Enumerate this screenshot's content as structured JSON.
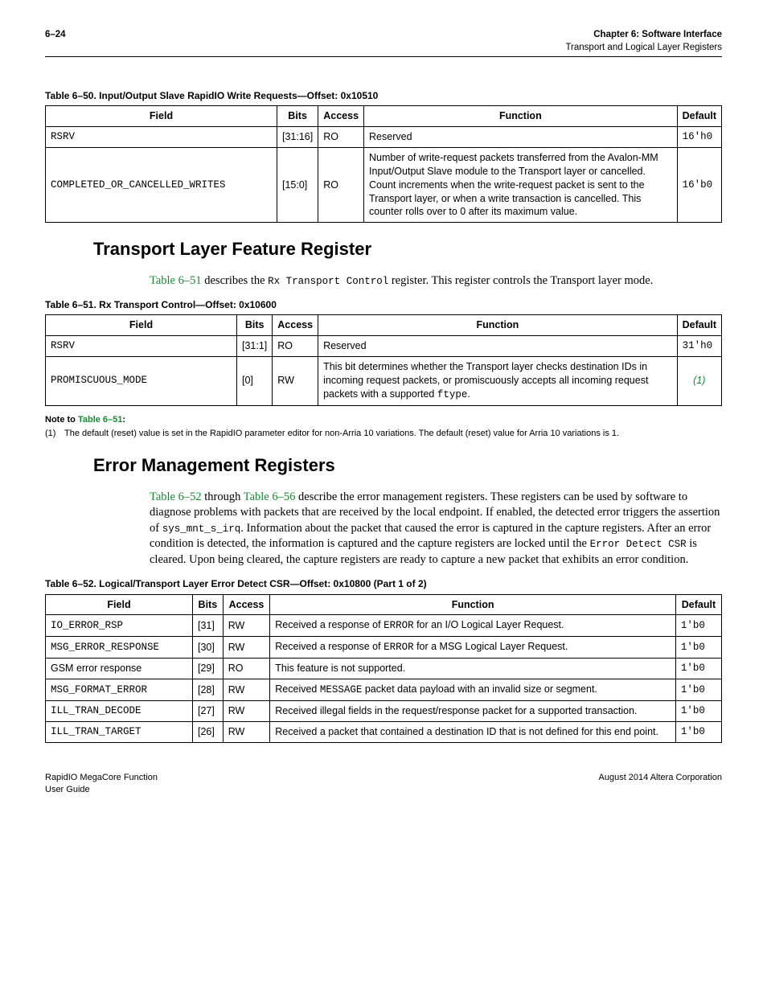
{
  "header": {
    "page": "6–24",
    "chapter": "Chapter 6:  Software Interface",
    "subtitle": "Transport and Logical Layer Registers"
  },
  "table50": {
    "caption": "Table 6–50. Input/Output Slave RapidIO Write Requests—Offset: 0x10510",
    "headers": [
      "Field",
      "Bits",
      "Access",
      "Function",
      "Default"
    ],
    "rows": [
      {
        "field": "RSRV",
        "bits": "[31:16]",
        "access": "RO",
        "function": "Reserved",
        "default": "16'h0"
      },
      {
        "field": "COMPLETED_OR_CANCELLED_WRITES",
        "bits": "[15:0]",
        "access": "RO",
        "function": "Number of write-request packets transferred from the Avalon-MM Input/Output Slave module to the Transport layer or cancelled. Count increments when the write-request packet is sent to the Transport layer, or when a write transaction is cancelled. This counter rolls over to 0 after its maximum value.",
        "default": "16'b0"
      }
    ]
  },
  "section1": {
    "title": "Transport Layer Feature Register",
    "body_pre": "Table 6–51",
    "body_mid": " describes the ",
    "body_code": "Rx Transport Control",
    "body_post": " register. This register controls the Transport layer mode."
  },
  "table51": {
    "caption": "Table 6–51. Rx Transport Control—Offset: 0x10600",
    "headers": [
      "Field",
      "Bits",
      "Access",
      "Function",
      "Default"
    ],
    "rows": [
      {
        "field": "RSRV",
        "bits": "[31:1]",
        "access": "RO",
        "function": "Reserved",
        "default": "31'h0",
        "default_plain": true
      },
      {
        "field": "PROMISCUOUS_MODE",
        "bits": "[0]",
        "access": "RW",
        "function_pre": "This bit determines whether the Transport layer checks destination IDs in incoming request packets, or promiscuously accepts all incoming request packets with a supported ",
        "function_code": "ftype",
        "function_post": ".",
        "default": "(1)",
        "default_ref": true
      }
    ],
    "note_label": "Note to ",
    "note_link": "Table 6–51",
    "note_colon": ":",
    "note_num": "(1)",
    "note_text": "The default (reset) value is set in the RapidIO parameter editor for non-Arria 10 variations. The default (reset) value for Arria 10 variations is 1."
  },
  "section2": {
    "title": "Error Management Registers",
    "link1": "Table 6–52",
    "mid1": " through ",
    "link2": "Table 6–56",
    "post1": " describe the error management registers. These registers can be used by software to diagnose problems with packets that are received by the local endpoint. If enabled, the detected error triggers the assertion of ",
    "code1": "sys_mnt_s_irq",
    "post2": ". Information about the packet that caused the error is captured in the capture registers. After an error condition is detected, the information is captured and the capture registers are locked until the ",
    "code2": "Error Detect CSR",
    "post3": " is cleared. Upon being cleared, the capture registers are ready to capture a new packet that exhibits an error condition."
  },
  "table52": {
    "caption": "Table 6–52. Logical/Transport Layer Error Detect CSR—Offset: 0x10800  (Part 1 of 2)",
    "headers": [
      "Field",
      "Bits",
      "Access",
      "Function",
      "Default"
    ],
    "rows": [
      {
        "field": "IO_ERROR_RSP",
        "field_mono": true,
        "bits": "[31]",
        "access": "RW",
        "fn_pre": "Received a response of ",
        "fn_code": "ERROR",
        "fn_post": " for an I/O Logical Layer Request.",
        "default": "1'b0"
      },
      {
        "field": "MSG_ERROR_RESPONSE",
        "field_mono": true,
        "bits": "[30]",
        "access": "RW",
        "fn_pre": "Received a response of ",
        "fn_code": "ERROR",
        "fn_post": " for a MSG Logical Layer Request.",
        "default": "1'b0"
      },
      {
        "field": "GSM error response",
        "field_mono": false,
        "bits": "[29]",
        "access": "RO",
        "fn_pre": "This feature is not supported.",
        "fn_code": "",
        "fn_post": "",
        "default": "1'b0"
      },
      {
        "field": "MSG_FORMAT_ERROR",
        "field_mono": true,
        "bits": "[28]",
        "access": "RW",
        "fn_pre": "Received ",
        "fn_code": "MESSAGE",
        "fn_post": " packet data payload with an invalid size or segment.",
        "default": "1'b0"
      },
      {
        "field": "ILL_TRAN_DECODE",
        "field_mono": true,
        "bits": "[27]",
        "access": "RW",
        "fn_pre": "Received illegal fields in the request/response packet for a supported transaction.",
        "fn_code": "",
        "fn_post": "",
        "default": "1'b0"
      },
      {
        "field": "ILL_TRAN_TARGET",
        "field_mono": true,
        "bits": "[26]",
        "access": "RW",
        "fn_pre": "Received a packet that contained a destination ID that is not defined for this end point.",
        "fn_code": "",
        "fn_post": "",
        "default": "1'b0"
      }
    ]
  },
  "footer": {
    "left1": "RapidIO MegaCore Function",
    "left2": "User Guide",
    "right": "August 2014   Altera Corporation"
  }
}
